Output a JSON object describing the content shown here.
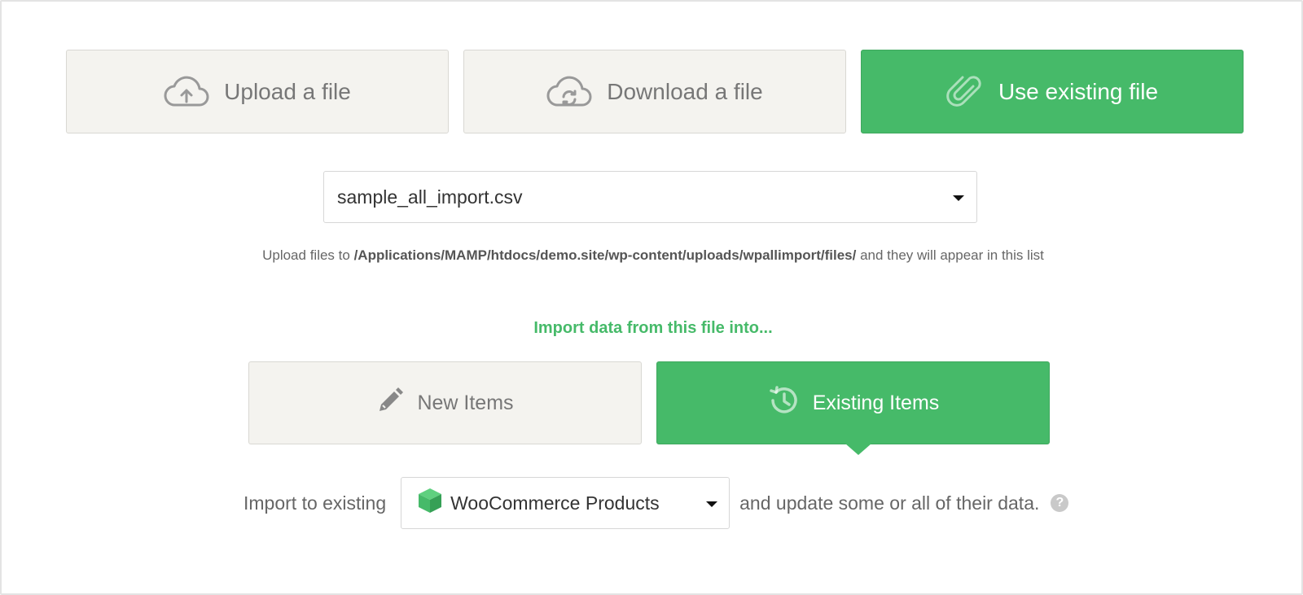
{
  "source_buttons": {
    "upload": {
      "label": "Upload a file",
      "icon": "cloud-upload-icon"
    },
    "download": {
      "label": "Download a file",
      "icon": "cloud-sync-icon"
    },
    "existing": {
      "label": "Use existing file",
      "icon": "paperclip-icon",
      "active": true
    }
  },
  "file_select": {
    "value": "sample_all_import.csv"
  },
  "hint": {
    "prefix": "Upload files to",
    "path": "/Applications/MAMP/htdocs/demo.site/wp-content/uploads/wpallimport/files/",
    "suffix": "and they will appear in this list"
  },
  "import_title": "Import data from this file into...",
  "mode_buttons": {
    "new": {
      "label": "New Items",
      "icon": "pencil-icon"
    },
    "existing": {
      "label": "Existing Items",
      "icon": "history-icon",
      "active": true
    }
  },
  "import_row": {
    "prefix": "Import to existing",
    "post_type": "WooCommerce Products",
    "post_type_icon": "woocommerce-box-icon",
    "suffix": "and update some or all of their data.",
    "help": "?"
  },
  "colors": {
    "accent": "#46ba69",
    "button_bg": "#f4f3ef",
    "text_muted": "#777777"
  }
}
